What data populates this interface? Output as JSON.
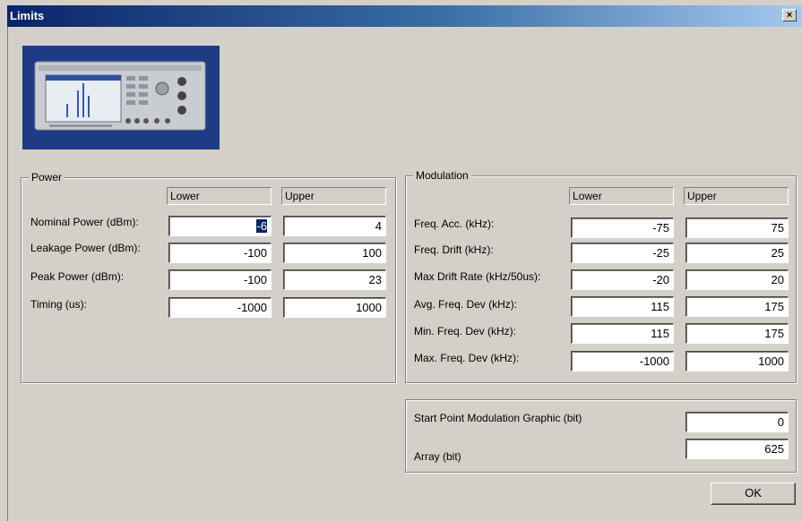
{
  "window": {
    "title": "Limits",
    "close_glyph": "×"
  },
  "power": {
    "legend": "Power",
    "col_lower": "Lower",
    "col_upper": "Upper",
    "rows": [
      {
        "label": "Nominal Power (dBm):",
        "lower": "-6",
        "upper": "4"
      },
      {
        "label": "Leakage Power (dBm):",
        "lower": "-100",
        "upper": "100"
      },
      {
        "label": "Peak Power (dBm):",
        "lower": "-100",
        "upper": "23"
      },
      {
        "label": "Timing (us):",
        "lower": "-1000",
        "upper": "1000"
      }
    ]
  },
  "modulation": {
    "legend": "Modulation",
    "col_lower": "Lower",
    "col_upper": "Upper",
    "rows": [
      {
        "label": "Freq. Acc. (kHz):",
        "lower": "-75",
        "upper": "75"
      },
      {
        "label": "Freq. Drift (kHz):",
        "lower": "-25",
        "upper": "25"
      },
      {
        "label": "Max Drift Rate (kHz/50us):",
        "lower": "-20",
        "upper": "20"
      },
      {
        "label": "Avg. Freq. Dev (kHz):",
        "lower": "115",
        "upper": "175"
      },
      {
        "label": "Min. Freq. Dev (kHz):",
        "lower": "115",
        "upper": "175"
      },
      {
        "label": "Max. Freq. Dev (kHz):",
        "lower": "-1000",
        "upper": "1000"
      }
    ]
  },
  "graphic": {
    "start_label": "Start Point Modulation Graphic (bit)",
    "start_value": "0",
    "array_label": "Array (bit)",
    "array_value": "625"
  },
  "ok_label": "OK",
  "colors": {
    "titlebar_start": "#0a246a",
    "titlebar_end": "#a6caf0",
    "dialog_bg": "#d4d0c8",
    "selection": "#0a246a"
  }
}
